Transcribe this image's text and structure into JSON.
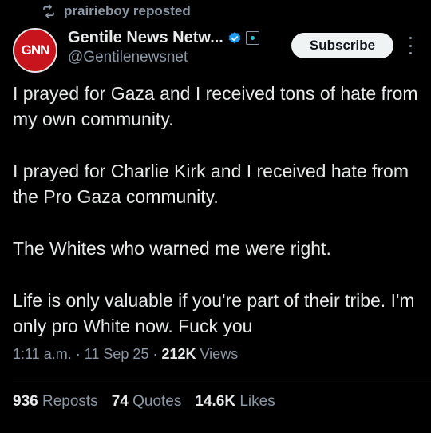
{
  "repost": {
    "icon": "repost-icon",
    "text": "prairieboy reposted"
  },
  "author": {
    "avatar_text": "GNN",
    "name": "Gentile News Netw...",
    "handle": "@Gentilenewsnet",
    "verified_icon": "verified-badge-icon",
    "affiliate_icon": "affiliate-badge-icon"
  },
  "subscribe_label": "Subscribe",
  "more_icon": "more-options-icon",
  "tweet": {
    "paragraphs": [
      "I prayed for Gaza and I received tons of hate from my own community.",
      "I prayed for Charlie Kirk and I received hate from the Pro Gaza community.",
      "The Whites who warned me were right.",
      "Life is only valuable if you're part of their tribe. I'm only pro White now. Fuck you"
    ]
  },
  "meta": {
    "time": "1:11 a.m.",
    "sep1": " · ",
    "date": "11 Sep 25",
    "sep2": " · ",
    "views_count": "212K",
    "views_label": " Views"
  },
  "stats": {
    "reposts_count": "936",
    "reposts_label": "Reposts",
    "quotes_count": "74",
    "quotes_label": "Quotes",
    "likes_count": "14.6K",
    "likes_label": "Likes"
  },
  "colors": {
    "background": "#000000",
    "text": "#e7e9ea",
    "muted": "#8b98a5",
    "verified": "#1d9bf0",
    "avatar": "#c8141c"
  }
}
